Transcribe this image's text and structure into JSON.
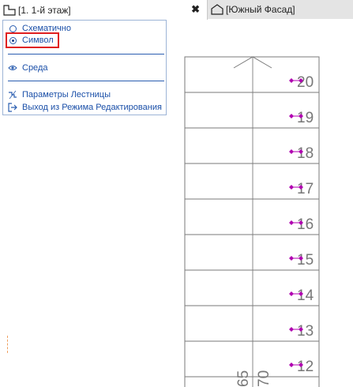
{
  "tabs": [
    {
      "label": "[1. 1-й этаж]",
      "icon": "floor-plan-icon",
      "active": true
    },
    {
      "label": "[Южный Фасад]",
      "icon": "elevation-house-icon",
      "active": false
    }
  ],
  "close_symbol": "✖",
  "menu": {
    "items": [
      {
        "label": "Схематично",
        "icon": "radio-button"
      },
      {
        "label": "Символ",
        "icon": "radio-button-selected",
        "highlighted": true
      },
      {
        "label": "Среда",
        "icon": "eye-icon"
      },
      {
        "label": "Параметры Лестницы",
        "icon": "stair-settings-icon"
      },
      {
        "label": "Выход из Режима Редактирования",
        "icon": "exit-icon"
      }
    ]
  },
  "stair": {
    "step_numbers": [
      "20",
      "19",
      "18",
      "17",
      "16",
      "15",
      "14",
      "13",
      "12"
    ],
    "bottom_labels": [
      "65",
      "70"
    ]
  },
  "colors": {
    "menu_text": "#1a4fa8",
    "menu_border": "#9db4d6",
    "highlight": "#e02020",
    "node_marker": "#b000b0",
    "line": "#7a7a7a"
  }
}
